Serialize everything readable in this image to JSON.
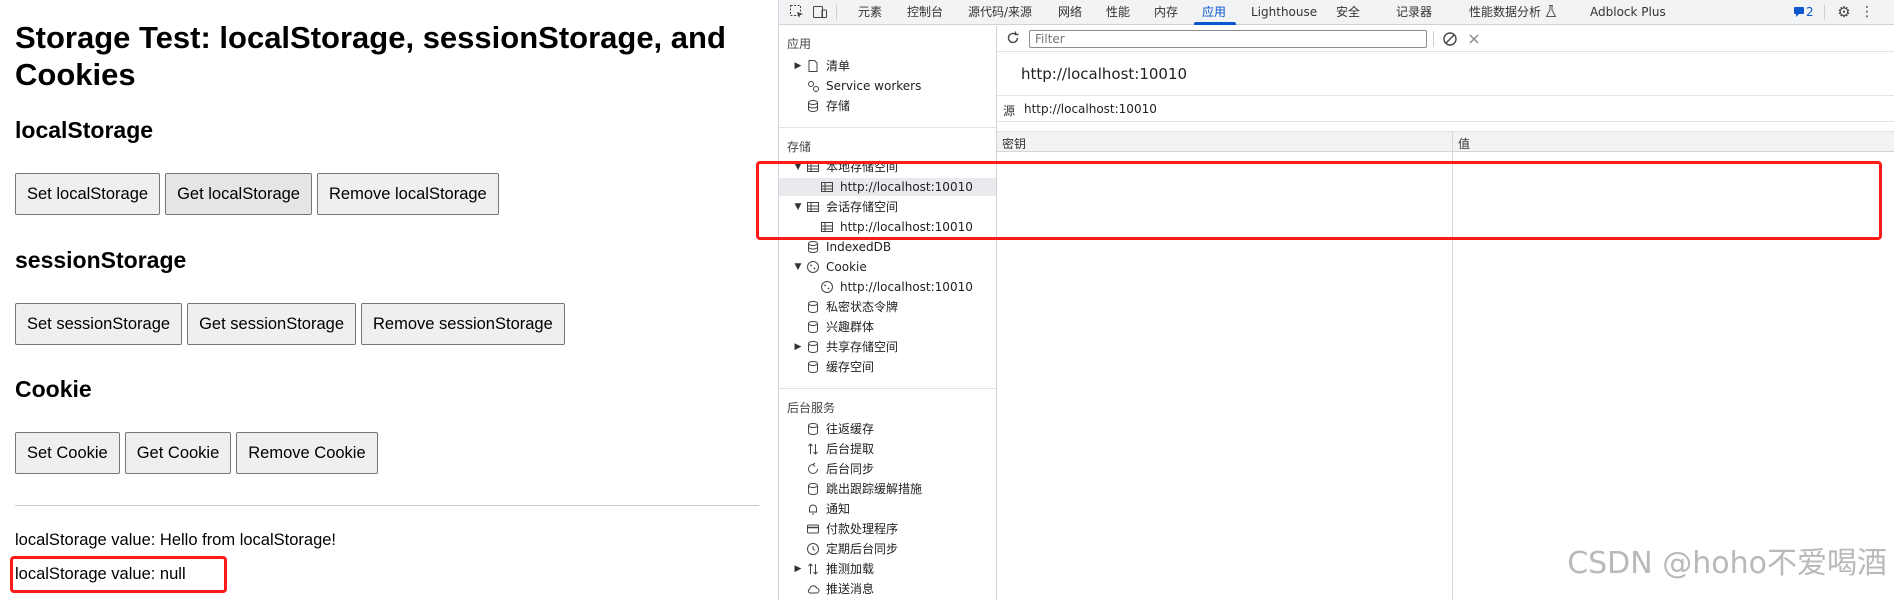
{
  "page": {
    "title": "Storage Test: localStorage, sessionStorage, and Cookies",
    "sections": {
      "local": {
        "heading": "localStorage",
        "buttons": [
          "Set localStorage",
          "Get localStorage",
          "Remove localStorage"
        ]
      },
      "session": {
        "heading": "sessionStorage",
        "buttons": [
          "Set sessionStorage",
          "Get sessionStorage",
          "Remove sessionStorage"
        ]
      },
      "cookie": {
        "heading": "Cookie",
        "buttons": [
          "Set Cookie",
          "Get Cookie",
          "Remove Cookie"
        ]
      }
    },
    "outputs": [
      "localStorage value: Hello from localStorage!",
      "localStorage value: null"
    ]
  },
  "devtools": {
    "tabs": [
      "元素",
      "控制台",
      "源代码/来源",
      "网络",
      "性能",
      "内存",
      "应用",
      "Lighthouse",
      "安全",
      "记录器",
      "性能数据分析",
      "Adblock Plus"
    ],
    "active_tab": "应用",
    "issues_count": "2",
    "sidebar": {
      "app_section": "应用",
      "app_items": [
        "清单",
        "Service workers",
        "存储"
      ],
      "storage_section": "存储",
      "storage_items": {
        "local_storage": "本地存储空间",
        "local_origin": "http://localhost:10010",
        "session_storage": "会话存储空间",
        "session_origin": "http://localhost:10010",
        "indexeddb": "IndexedDB",
        "cookie": "Cookie",
        "cookie_origin": "http://localhost:10010",
        "private_state": "私密状态令牌",
        "interest_groups": "兴趣群体",
        "shared_storage": "共享存储空间",
        "cache_storage": "缓存空间"
      },
      "bg_section": "后台服务",
      "bg_items": [
        "往返缓存",
        "后台提取",
        "后台同步",
        "跳出跟踪缓解措施",
        "通知",
        "付款处理程序",
        "定期后台同步",
        "推测加载",
        "推送消息"
      ]
    },
    "main": {
      "filter_placeholder": "Filter",
      "origin_title": "http://localhost:10010",
      "origin_label": "源",
      "origin_value": "http://localhost:10010",
      "col_key": "密钥",
      "col_value": "值"
    },
    "watermark": "CSDN @hoho不爱喝酒",
    "colors": {
      "accent": "#0b57d0",
      "highlight": "#ff1a1a"
    }
  }
}
